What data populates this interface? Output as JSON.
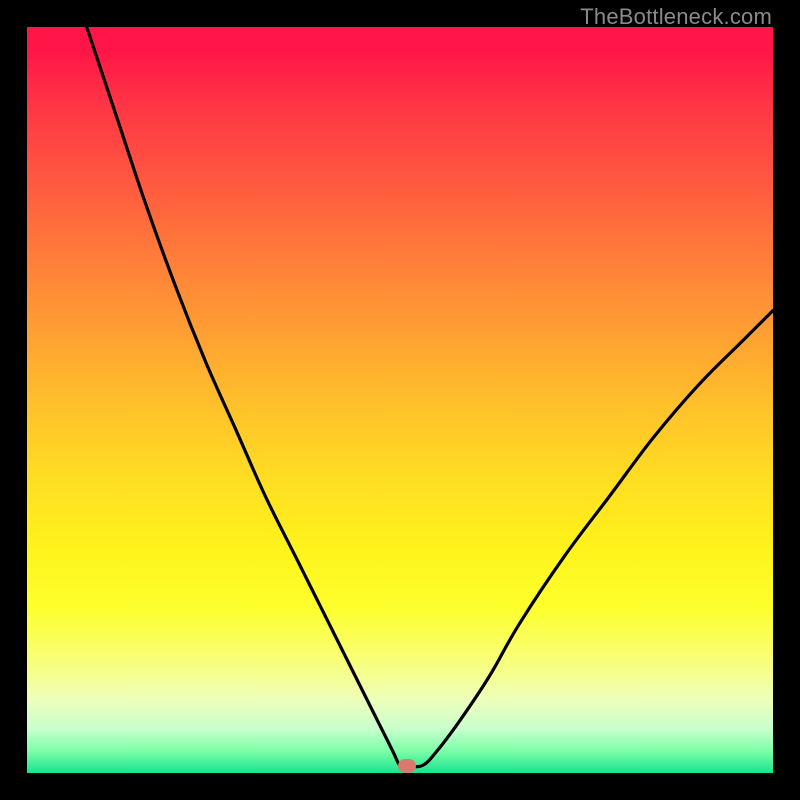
{
  "watermark": "TheBottleneck.com",
  "colors": {
    "frame": "#000000",
    "curve": "#000000",
    "marker": "#d97a6c",
    "gradient_top": "#ff1547",
    "gradient_bottom": "#18e38f"
  },
  "chart_data": {
    "type": "line",
    "title": "",
    "xlabel": "",
    "ylabel": "",
    "xlim": [
      0,
      100
    ],
    "ylim": [
      0,
      100
    ],
    "axes_visible": false,
    "grid": false,
    "legend": false,
    "series": [
      {
        "name": "bottleneck-curve",
        "x": [
          8,
          12,
          16,
          20,
          24,
          28,
          32,
          36,
          40,
          44,
          47,
          49,
          50,
          51,
          53,
          55,
          58,
          62,
          66,
          72,
          78,
          84,
          90,
          96,
          100
        ],
        "y": [
          100,
          88,
          76,
          65,
          55,
          46,
          37,
          29,
          21,
          13,
          7,
          3,
          1,
          1,
          1,
          3,
          7,
          13,
          20,
          29,
          37,
          45,
          52,
          58,
          62
        ]
      }
    ],
    "marker": {
      "x": 51,
      "y": 1
    },
    "background": "vertical-gradient red→orange→yellow→green"
  }
}
